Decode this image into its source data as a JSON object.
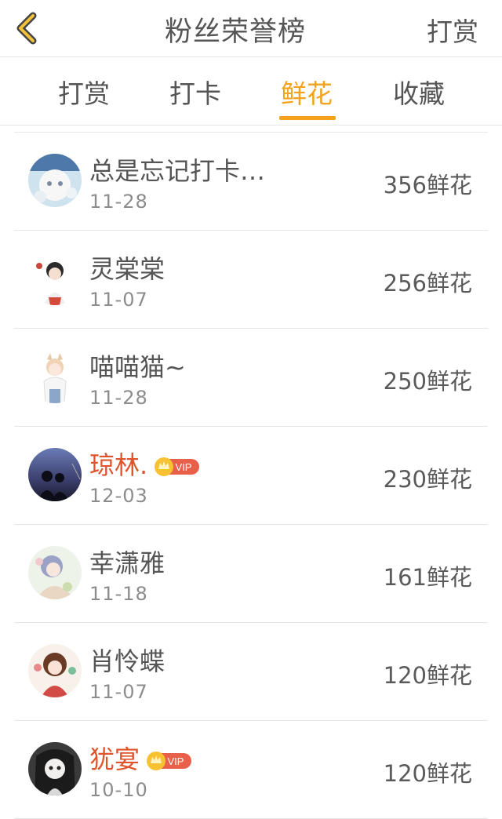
{
  "header": {
    "title": "粉丝荣誉榜",
    "action_label": "打赏"
  },
  "tabs": [
    {
      "label": "打赏",
      "active": false
    },
    {
      "label": "打卡",
      "active": false
    },
    {
      "label": "鲜花",
      "active": true
    },
    {
      "label": "收藏",
      "active": false
    }
  ],
  "colors": {
    "accent": "#f2a31b",
    "vip_name": "#e0542c"
  },
  "vip_badge_text": "VIP",
  "fans": [
    {
      "name": "总是忘记打卡…",
      "date": "11-28",
      "amount": "356鲜花",
      "vip": false
    },
    {
      "name": "灵棠棠",
      "date": "11-07",
      "amount": "256鲜花",
      "vip": false
    },
    {
      "name": "喵喵猫~",
      "date": "11-28",
      "amount": "250鲜花",
      "vip": false
    },
    {
      "name": "琼林.",
      "date": "12-03",
      "amount": "230鲜花",
      "vip": true
    },
    {
      "name": "幸潇雅",
      "date": "11-18",
      "amount": "161鲜花",
      "vip": false
    },
    {
      "name": "肖怜蝶",
      "date": "11-07",
      "amount": "120鲜花",
      "vip": false
    },
    {
      "name": "犹宴",
      "date": "10-10",
      "amount": "120鲜花",
      "vip": true
    }
  ]
}
